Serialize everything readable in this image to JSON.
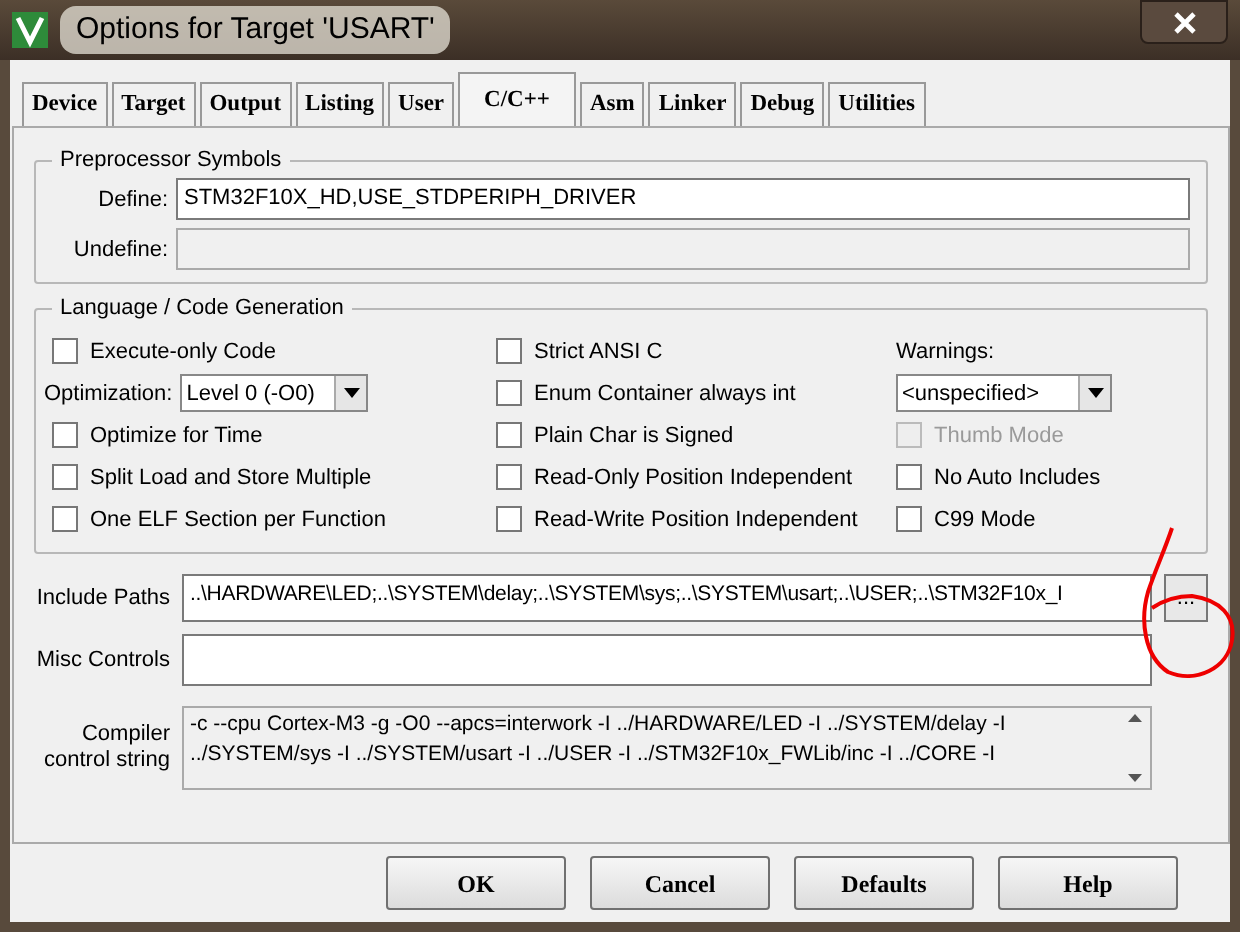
{
  "window": {
    "title": "Options for Target 'USART'"
  },
  "tabs": [
    {
      "label": "Device",
      "selected": false
    },
    {
      "label": "Target",
      "selected": false
    },
    {
      "label": "Output",
      "selected": false
    },
    {
      "label": "Listing",
      "selected": false
    },
    {
      "label": "User",
      "selected": false
    },
    {
      "label": "C/C++",
      "selected": true
    },
    {
      "label": "Asm",
      "selected": false
    },
    {
      "label": "Linker",
      "selected": false
    },
    {
      "label": "Debug",
      "selected": false
    },
    {
      "label": "Utilities",
      "selected": false
    }
  ],
  "preprocessor": {
    "title": "Preprocessor Symbols",
    "fields": [
      {
        "label": "Define:",
        "value": "STM32F10X_HD,USE_STDPERIPH_DRIVER",
        "disabled": false
      },
      {
        "label": "Undefine:",
        "disabled": true
      }
    ]
  },
  "language": {
    "title": "Language / Code Generation",
    "columns": [
      [
        {
          "kind": "checkbox",
          "label": "Execute-only Code",
          "checked": false,
          "disabled": false
        },
        {
          "kind": "select",
          "label": "Optimization:",
          "value": "Level 0 (-O0)"
        },
        {
          "kind": "checkbox",
          "label": "Optimize for Time",
          "checked": false,
          "disabled": false
        },
        {
          "kind": "checkbox",
          "label": "Split Load and Store Multiple",
          "checked": false,
          "disabled": false
        },
        {
          "kind": "checkbox",
          "label": "One ELF Section per Function",
          "checked": false,
          "disabled": false
        }
      ],
      [
        {
          "kind": "checkbox",
          "label": "Strict ANSI C",
          "checked": false,
          "disabled": false
        },
        {
          "kind": "checkbox",
          "label": "Enum Container always int",
          "checked": false,
          "disabled": false
        },
        {
          "kind": "checkbox",
          "label": "Plain Char is Signed",
          "checked": false,
          "disabled": false
        },
        {
          "kind": "checkbox",
          "label": "Read-Only Position Independent",
          "checked": false,
          "disabled": false
        },
        {
          "kind": "checkbox",
          "label": "Read-Write Position Independent",
          "checked": false,
          "disabled": false
        }
      ],
      [
        {
          "kind": "label",
          "label": "Warnings:"
        },
        {
          "kind": "select",
          "value": "<unspecified>"
        },
        {
          "kind": "checkbox",
          "label": "Thumb Mode",
          "checked": false,
          "disabled": true
        },
        {
          "kind": "checkbox",
          "label": "No Auto Includes",
          "checked": false,
          "disabled": false
        },
        {
          "kind": "checkbox",
          "label": "C99 Mode",
          "checked": false,
          "disabled": false
        }
      ]
    ]
  },
  "include_paths": {
    "label": "Include Paths",
    "value": "..\\HARDWARE\\LED;..\\SYSTEM\\delay;..\\SYSTEM\\sys;..\\SYSTEM\\usart;..\\USER;..\\STM32F10x_I",
    "browse": "..."
  },
  "misc_controls": {
    "label": "Misc Controls"
  },
  "compiler_control": {
    "label": "Compiler control string",
    "value": "-c --cpu Cortex-M3 -g -O0 --apcs=interwork -I ../HARDWARE/LED -I ../SYSTEM/delay -I ../SYSTEM/sys -I ../SYSTEM/usart -I ../USER -I ../STM32F10x_FWLib/inc -I ../CORE -I"
  },
  "buttons": [
    "OK",
    "Cancel",
    "Defaults",
    "Help"
  ]
}
